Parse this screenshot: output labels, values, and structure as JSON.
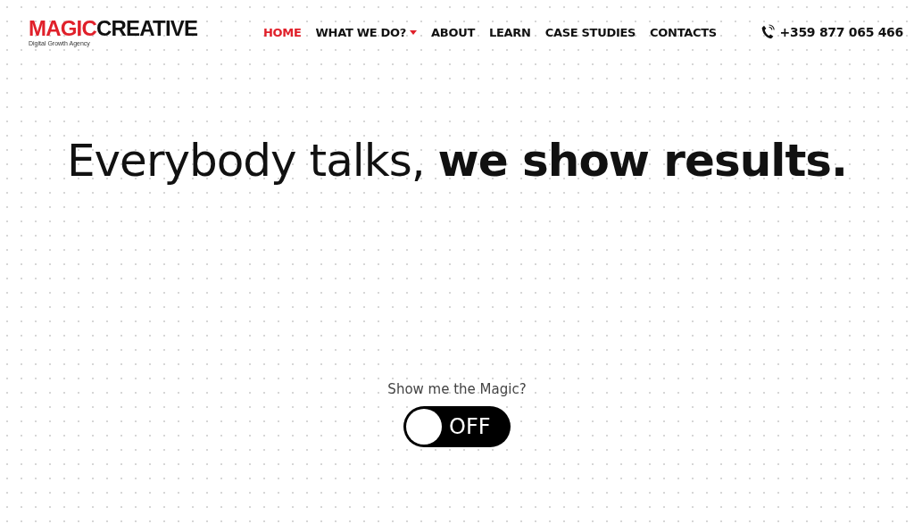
{
  "logo": {
    "first": "MAGIC",
    "second": "CREATIVE",
    "tagline": "Digital Growth Agency"
  },
  "nav": [
    {
      "label": "HOME",
      "selected": true,
      "has_menu": false
    },
    {
      "label": "WHAT WE DO?",
      "selected": false,
      "has_menu": true
    },
    {
      "label": "ABOUT",
      "selected": false,
      "has_menu": false
    },
    {
      "label": "LEARN",
      "selected": false,
      "has_menu": false
    },
    {
      "label": "CASE STUDIES",
      "selected": false,
      "has_menu": false
    },
    {
      "label": "CONTACTS",
      "selected": false,
      "has_menu": false
    }
  ],
  "phone": "+359 877 065 466",
  "headline": "Everybody talks, **we show results.**",
  "magic_toggle": {
    "question": "Show me the Magic?",
    "on": false,
    "label": "OFF"
  }
}
